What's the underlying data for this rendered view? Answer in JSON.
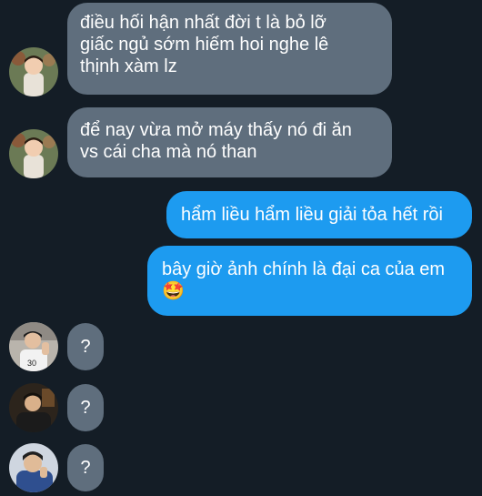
{
  "conversation": {
    "messages": [
      {
        "direction": "incoming",
        "sender": "baby-avatar",
        "lines": [
          "điều hối hận nhất đời t là bỏ lỡ",
          "giấc ngủ sớm hiếm hoi nghe lê",
          "thịnh xàm lz"
        ]
      },
      {
        "direction": "incoming",
        "sender": "baby-avatar",
        "lines": [
          "để nay vừa mở máy thấy nó đi ăn",
          "vs cái cha mà nó than"
        ]
      },
      {
        "direction": "outgoing",
        "lines": [
          "hẩm liều hẩm liều giải tỏa hết rồi"
        ]
      },
      {
        "direction": "outgoing",
        "lines": [
          "bây giờ ảnh chính là đại ca của em",
          "🤩"
        ]
      },
      {
        "direction": "incoming",
        "sender": "white-shirt-avatar",
        "lines": [
          "?"
        ]
      },
      {
        "direction": "incoming",
        "sender": "dark-jacket-avatar",
        "lines": [
          "?"
        ]
      },
      {
        "direction": "incoming",
        "sender": "blue-shirt-avatar",
        "lines": [
          "?"
        ]
      }
    ]
  },
  "colors": {
    "background": "#141d26",
    "incoming_bubble": "#5f6e7d",
    "outgoing_bubble": "#1d9bf0",
    "text": "#ffffff"
  }
}
